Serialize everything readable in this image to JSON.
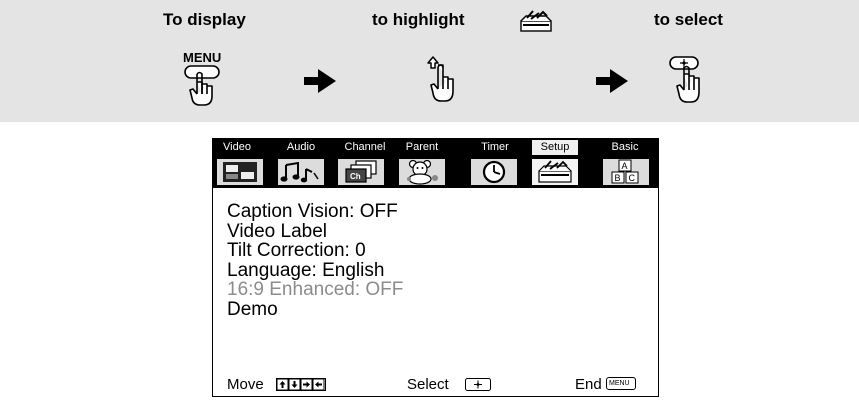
{
  "instructions": {
    "steps": [
      {
        "title": "To display",
        "button_label": "MENU"
      },
      {
        "title": "to highlight",
        "icon": "setup-toolbox-icon"
      },
      {
        "title": "to select",
        "icon": "select-button-icon"
      }
    ]
  },
  "menu": {
    "tabs": [
      {
        "label": "Video",
        "icon": "video-screen-icon"
      },
      {
        "label": "Audio",
        "icon": "music-note-icon"
      },
      {
        "label": "Channel",
        "icon": "channel-ch-icon"
      },
      {
        "label": "Parent",
        "icon": "teddy-bear-icon"
      },
      {
        "label": "Timer",
        "icon": "clock-icon"
      },
      {
        "label": "Setup",
        "icon": "toolbox-icon",
        "active": true
      },
      {
        "label": "Basic",
        "icon": "abc-blocks-icon"
      }
    ],
    "items": [
      {
        "label": "Caption Vision:  OFF",
        "enabled": true
      },
      {
        "label": "Video Label",
        "enabled": true
      },
      {
        "label": "Tilt Correction:  0",
        "enabled": true
      },
      {
        "label": "Language:  English",
        "enabled": true
      },
      {
        "label": "16:9 Enhanced:  OFF",
        "enabled": false
      },
      {
        "label": "Demo",
        "enabled": true
      }
    ],
    "footer": {
      "move_label": "Move",
      "select_label": "Select",
      "end_label": "End",
      "end_key_label": "MENU"
    }
  },
  "colors": {
    "band_background": "#e4e4e4",
    "disabled_text": "#8c8c8c"
  }
}
